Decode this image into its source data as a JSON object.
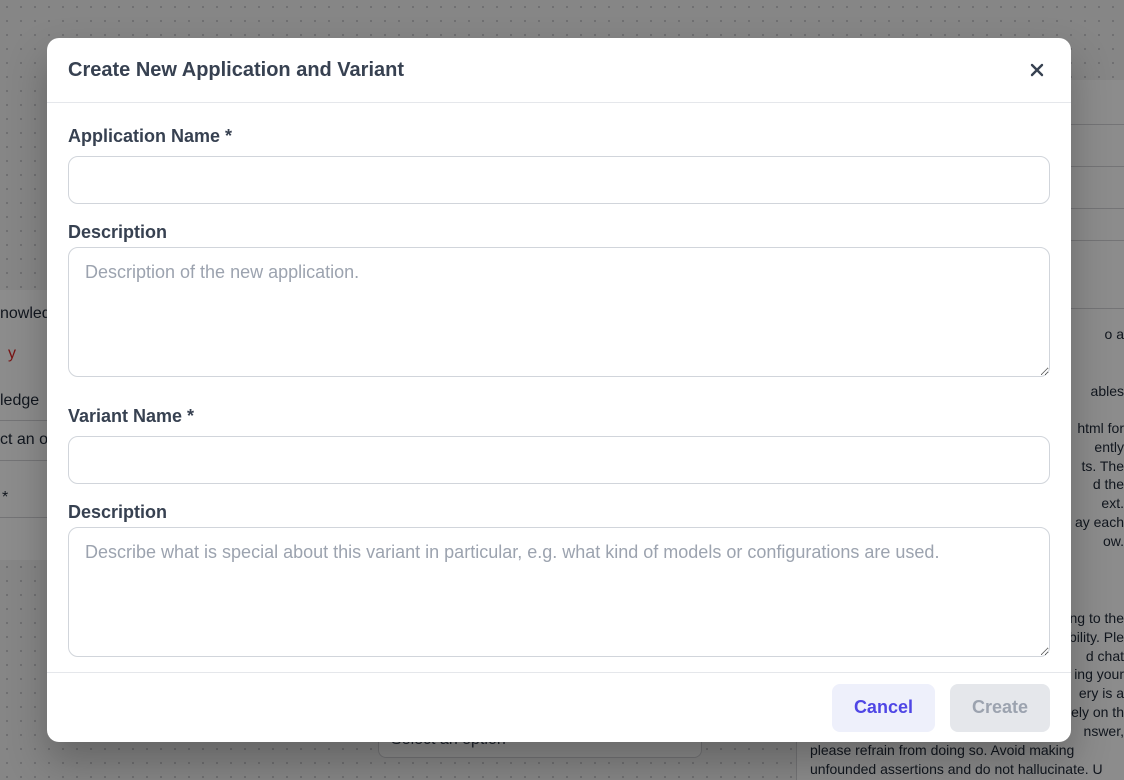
{
  "background": {
    "left_fragments": [
      "nowled",
      "y",
      "*",
      "ledge",
      "ct an o",
      "*"
    ],
    "right_fragments": [
      "o a",
      "ables",
      "html for\nently\nts. The\nd the\next.\nay each\now.",
      "ing to the\nbility. Ple\nd chat\ning your\nery is a\nely on th\nnswer,"
    ],
    "bottom_select": "Select an option",
    "bottom_text": "please refrain from doing so. Avoid making\nunfounded assertions and do not hallucinate. U"
  },
  "modal": {
    "title": "Create New Application and Variant",
    "fields": {
      "app_name_label": "Application Name *",
      "app_name_value": "",
      "app_description_label": "Description",
      "app_description_placeholder": "Description of the new application.",
      "variant_name_label": "Variant Name *",
      "variant_name_value": "",
      "variant_description_label": "Description",
      "variant_description_placeholder": "Describe what is special about this variant in particular, e.g. what kind of models or configurations are used."
    },
    "footer": {
      "cancel_label": "Cancel",
      "create_label": "Create"
    }
  },
  "icons": {
    "close": "close-icon",
    "resize": "resize-handle-icon"
  },
  "colors": {
    "accent": "#4f46e5",
    "accent_bg": "#eef0fb",
    "disabled_bg": "#e5e7eb",
    "disabled_text": "#9ca3af"
  }
}
